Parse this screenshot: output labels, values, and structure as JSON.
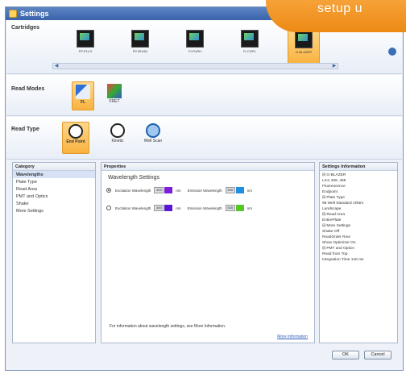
{
  "window": {
    "title": "Settings"
  },
  "banner": {
    "text": "setup u"
  },
  "cartridges": {
    "label": "Cartridges",
    "items": [
      {
        "name": "FP-PLLO",
        "selected": false
      },
      {
        "name": "FP-RHOD",
        "selected": false
      },
      {
        "name": "FI-FURH",
        "selected": false
      },
      {
        "name": "FI-COPL",
        "selected": false
      },
      {
        "name": "G-BLAZER",
        "selected": true
      }
    ],
    "chips": [
      "FP",
      "FP",
      "FI",
      "FI",
      "FI"
    ]
  },
  "read_modes": {
    "label": "Read Modes",
    "items": [
      {
        "label": "FL",
        "selected": true
      },
      {
        "label": "FRET",
        "selected": false
      }
    ]
  },
  "read_type": {
    "label": "Read Type",
    "items": [
      {
        "label": "End Point",
        "selected": true,
        "icon": "end-point-icon"
      },
      {
        "label": "Kinetic",
        "selected": false,
        "icon": "clock-icon"
      },
      {
        "label": "Well Scan",
        "selected": false,
        "icon": "well-scan-icon"
      }
    ]
  },
  "category": {
    "header": "Category",
    "items": [
      "Wavelengths",
      "Plate Type",
      "Read Area",
      "PMT and Optics",
      "Shake",
      "More Settings"
    ],
    "active": "Wavelengths"
  },
  "properties": {
    "header": "Properties",
    "title": "Wavelength Settings",
    "rows": [
      {
        "excitation_label": "Excitation Wavelength",
        "excitation_value": "405",
        "excitation_unit": "nm",
        "excitation_color": "#7b1fd6",
        "emission_label": "Emission Wavelength",
        "emission_value": "465",
        "emission_unit": "nm",
        "emission_color": "#1f8fe0",
        "selected": true
      },
      {
        "excitation_label": "Excitation Wavelength",
        "excitation_value": "400",
        "excitation_unit": "nm",
        "excitation_color": "#5a18d0",
        "emission_label": "Emission Wavelength",
        "emission_value": "535",
        "emission_unit": "nm",
        "emission_color": "#56c62a",
        "selected": false
      }
    ],
    "footer_text": "For information about wavelength settings, see More Information.",
    "more_link": "More Information"
  },
  "settings_info": {
    "header": "Settings Information",
    "lines": [
      "⊟ G-BLAZER",
      "    Lm1   406, 465",
      "      Fluorescence",
      "      Endpoint",
      "⊟ Plate Type",
      "    96 Well Standard clrbtm",
      "    Landscape",
      "⊟ Read Area",
      "    EntirePlate",
      "⊟ More Settings",
      "    Shake  Off",
      "    ReadOrder  Row",
      "    Show Optimizer  On",
      "⊟ PMT and Optics",
      "    Read from  Top",
      "    Integration Time  140 ms"
    ]
  },
  "buttons": {
    "ok": "OK",
    "cancel": "Cancel"
  },
  "colors": {
    "accent": "#f9b23f",
    "title_bar": "#3a63aa",
    "banner": "#ec8a14",
    "link": "#2a5cb8"
  }
}
